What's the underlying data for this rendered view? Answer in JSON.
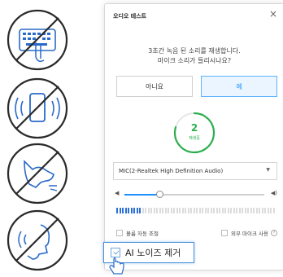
{
  "dialog": {
    "title": "오디오 테스트",
    "close_glyph": "×",
    "message_line1": "3초간 녹음 된 소리를 재생합니다.",
    "message_line2": "마이크 소리가 들리시나요?",
    "no_label": "아니요",
    "yes_label": "예",
    "timer_value": "2",
    "timer_status": "재생중",
    "mic_select_value": "MIC(2-Realtek High Definition Audio)",
    "volume_low_glyph": "◀",
    "volume_high_glyph": "◀)",
    "volume_level": 0.25,
    "meter_active_fraction": 0.16,
    "auto_volume_label": "볼륨 자동 조절",
    "external_mic_label": "외부 마이크 사용",
    "help_glyph": "?",
    "ai_noise_label": "AI 노이즈 제거"
  },
  "colors": {
    "accent": "#1e90ff",
    "timer_green": "#2cae4f",
    "meter_on": "#2b6fd6"
  },
  "left_icons": [
    "keyboard-typing-prohibited-icon",
    "phone-ringing-prohibited-icon",
    "dog-barking-prohibited-icon",
    "speaking-noise-prohibited-icon"
  ]
}
